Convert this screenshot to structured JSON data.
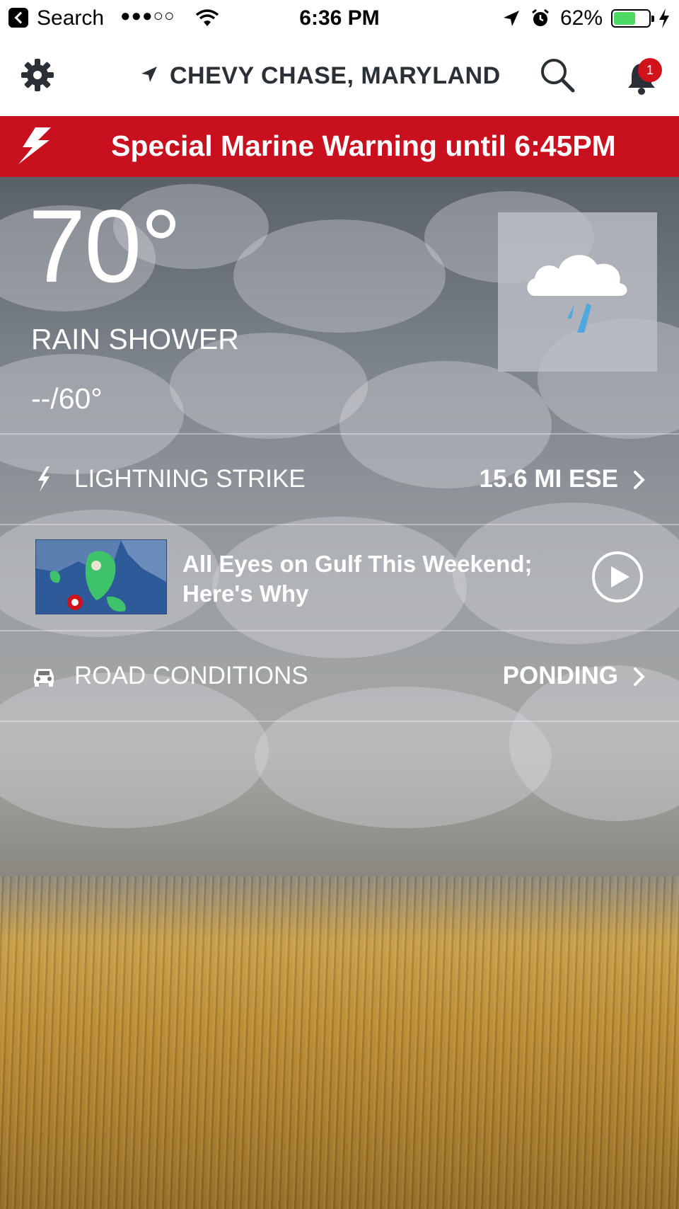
{
  "status_bar": {
    "back_label": "Search",
    "signal": "●●●○○",
    "time": "6:36 PM",
    "battery_percent_text": "62%",
    "battery_level": 0.62
  },
  "header": {
    "location": "CHEVY CHASE, MARYLAND",
    "notification_count": "1"
  },
  "alert": {
    "text": "Special Marine Warning until 6:45PM",
    "color": "#c8101f"
  },
  "current": {
    "temperature": "70°",
    "condition": "RAIN SHOWER",
    "hi_lo": "--/60°",
    "icon": "rain-shower-icon"
  },
  "rows": {
    "lightning": {
      "label": "LIGHTNING STRIKE",
      "value": "15.6 MI ESE",
      "icon": "lightning-icon"
    },
    "video": {
      "title": "All Eyes on Gulf This Weekend; Here's Why",
      "icon": "play-icon"
    },
    "road": {
      "label": "ROAD CONDITIONS",
      "value": "PONDING",
      "icon": "car-icon"
    }
  }
}
